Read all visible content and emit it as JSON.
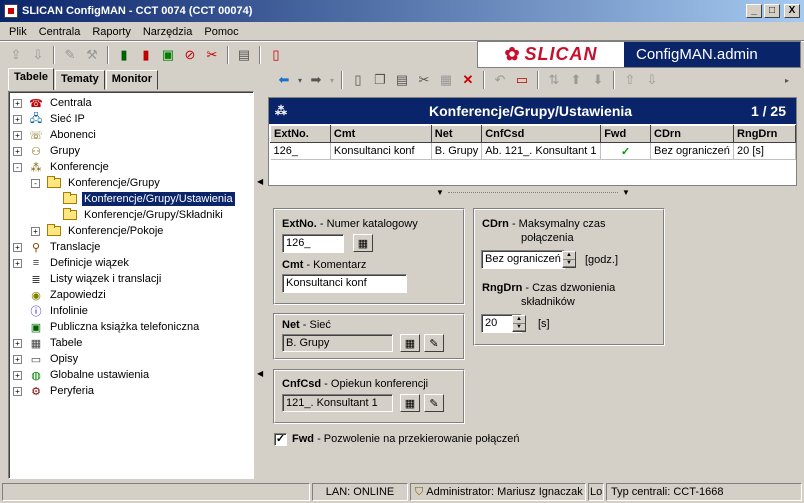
{
  "window": {
    "title": "SLICAN ConfigMAN - CCT 0074 (CCT 00074)",
    "buttons": [
      "_",
      "□",
      "X"
    ]
  },
  "menu": [
    "Plik",
    "Centrala",
    "Raporty",
    "Narzędzia",
    "Pomoc"
  ],
  "banner": {
    "logo": "SLICAN",
    "product": "ConfigMAN.admin"
  },
  "tabs": [
    "Tabele",
    "Tematy",
    "Monitor"
  ],
  "tree": [
    {
      "label": "Centrala",
      "expander": "+",
      "icon": "centrala-icon",
      "glyph": "☎",
      "color": "#c00000"
    },
    {
      "label": "Sieć IP",
      "expander": "+",
      "icon": "network-icon",
      "glyph": "🖧",
      "color": "#0060a0"
    },
    {
      "label": "Abonenci",
      "expander": "+",
      "icon": "subscribers-icon",
      "glyph": "☏",
      "color": "#806000"
    },
    {
      "label": "Grupy",
      "expander": "+",
      "icon": "groups-icon",
      "glyph": "⚇",
      "color": "#806000"
    },
    {
      "label": "Konferencje",
      "expander": "-",
      "icon": "conference-icon",
      "glyph": "⁂",
      "color": "#806000"
    },
    {
      "label": "Konferencje/Grupy",
      "expander": "-",
      "icon": "folder-icon",
      "folder": true
    },
    {
      "label": "Konferencje/Grupy/Ustawienia",
      "icon": "folder-icon",
      "folder": true,
      "selected": true
    },
    {
      "label": "Konferencje/Grupy/Składniki",
      "icon": "folder-icon",
      "folder": true
    },
    {
      "label": "Konferencje/Pokoje",
      "expander": "+",
      "icon": "folder-icon",
      "folder": true
    },
    {
      "label": "Translacje",
      "expander": "+",
      "icon": "translation-icon",
      "glyph": "⚲",
      "color": "#804000"
    },
    {
      "label": "Definicje wiązek",
      "expander": "+",
      "icon": "trunk-icon",
      "glyph": "≡",
      "color": "#404040"
    },
    {
      "label": "Listy wiązek i translacji",
      "icon": "list-icon",
      "glyph": "≣",
      "color": "#404040"
    },
    {
      "label": "Zapowiedzi",
      "icon": "announcement-icon",
      "glyph": "◉",
      "color": "#808000"
    },
    {
      "label": "Infolinie",
      "icon": "infoline-icon",
      "glyph": "ⓘ",
      "color": "#0000c0"
    },
    {
      "label": "Publiczna książka telefoniczna",
      "icon": "phonebook-icon",
      "glyph": "▣",
      "color": "#006000"
    },
    {
      "label": "Tabele",
      "expander": "+",
      "icon": "table-icon",
      "glyph": "▦",
      "color": "#404040"
    },
    {
      "label": "Opisy",
      "expander": "+",
      "icon": "descriptions-icon",
      "glyph": "▭",
      "color": "#404040"
    },
    {
      "label": "Globalne ustawienia",
      "expander": "+",
      "icon": "globe-icon",
      "glyph": "◍",
      "color": "#008000"
    },
    {
      "label": "Peryferia",
      "expander": "+",
      "icon": "peripherals-icon",
      "glyph": "⚙",
      "color": "#800000"
    }
  ],
  "grid": {
    "title": "Konferencje/Grupy/Ustawienia",
    "count": "1 / 25",
    "columns": [
      "ExtNo.",
      "Cmt",
      "Net",
      "CnfCsd",
      "Fwd",
      "CDrn",
      "RngDrn"
    ],
    "rows": [
      {
        "extno": "126_",
        "cmt": "Konsultanci konf",
        "net": "B. Grupy",
        "cnfcsd": "Ab. 121_. Konsultant 1",
        "fwd": "✓",
        "cdrn": "Bez ograniczeń",
        "rngdrn": "20 [s]"
      }
    ]
  },
  "form": {
    "extno": {
      "label": "ExtNo.",
      "desc": "- Numer katalogowy",
      "value": "126_"
    },
    "cmt": {
      "label": "Cmt",
      "desc": "- Komentarz",
      "value": "Konsultanci konf"
    },
    "net": {
      "label": "Net",
      "desc": "- Sieć",
      "value": "B. Grupy"
    },
    "cnfcsd": {
      "label": "CnfCsd",
      "desc": "- Opiekun konferencji",
      "value": "121_. Konsultant 1"
    },
    "cdrn": {
      "label": "CDrn",
      "desc1": "- Maksymalny czas",
      "desc2": "połączenia",
      "value": "Bez ograniczeń",
      "unit": "[godz.]"
    },
    "rngdrn": {
      "label": "RngDrn",
      "desc1": "- Czas dzwonienia",
      "desc2": "składników",
      "value": "20",
      "unit": "[s]"
    },
    "fwd": {
      "label": "Fwd",
      "desc": "- Pozwolenie na przekierowanie połączeń",
      "checked": "✓"
    }
  },
  "status": {
    "lan": "LAN: ONLINE",
    "user": "Administrator: Mariusz Ignaczak",
    "mode": "Lol",
    "central_type": "Typ centrali: CCT-1668"
  }
}
